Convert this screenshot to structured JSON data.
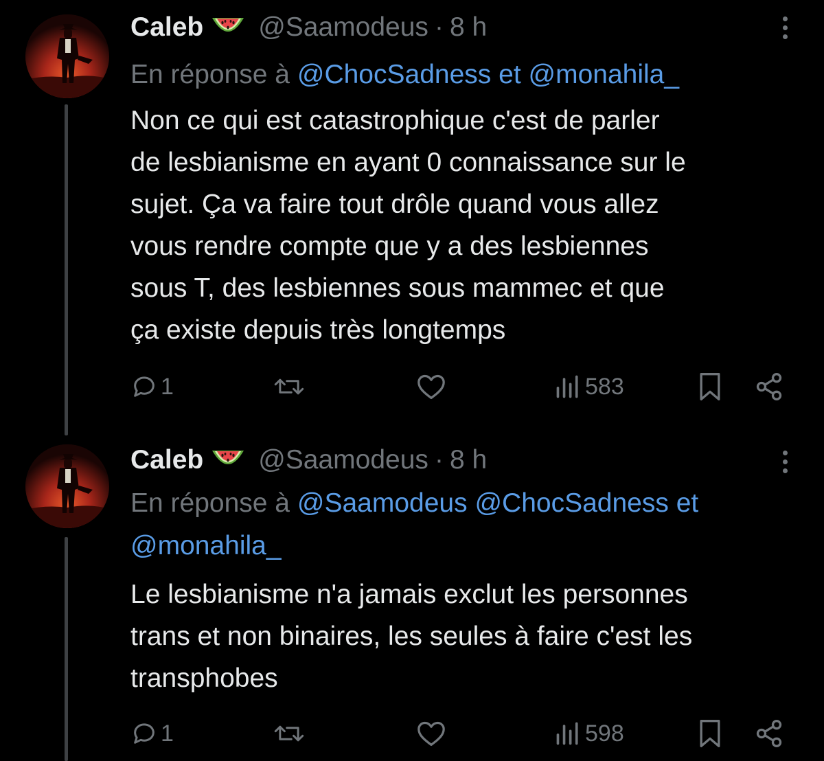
{
  "colors": {
    "background": "#000000",
    "text": "#e7e9ea",
    "muted": "#71767b",
    "link": "#5a9ce6"
  },
  "tweets": [
    {
      "author_name": "Caleb",
      "author_emoji": "watermelon-emoji",
      "handle": "@Saamodeus",
      "separator": "·",
      "time": "8 h",
      "reply_prefix": "En réponse à",
      "reply_mention_1": "@ChocSadness",
      "reply_joiner": "et",
      "reply_mention_2": "@monahila_",
      "text_lines": [
        "Non ce qui est catastrophique c'est de parler",
        "de lesbianisme en ayant 0 connaissance sur le",
        "sujet. Ça va faire tout drôle quand vous allez",
        "vous rendre compte que y a des lesbiennes",
        "sous T, des lesbiennes sous mammec et que",
        "ça existe depuis très longtemps"
      ],
      "reply_count": "1",
      "views": "583"
    },
    {
      "author_name": "Caleb",
      "author_emoji": "watermelon-emoji",
      "handle": "@Saamodeus",
      "separator": "·",
      "time": "8 h",
      "reply_prefix": "En réponse à",
      "reply_mention_1": "@Saamodeus",
      "reply_mention_2": "@ChocSadness",
      "reply_joiner": "et",
      "reply_mention_3": "@monahila_",
      "text_lines": [
        "Le lesbianisme n'a jamais exclut les personnes",
        "trans et non binaires, les seules à faire c'est les",
        "transphobes"
      ],
      "reply_count": "1",
      "views": "598"
    }
  ]
}
